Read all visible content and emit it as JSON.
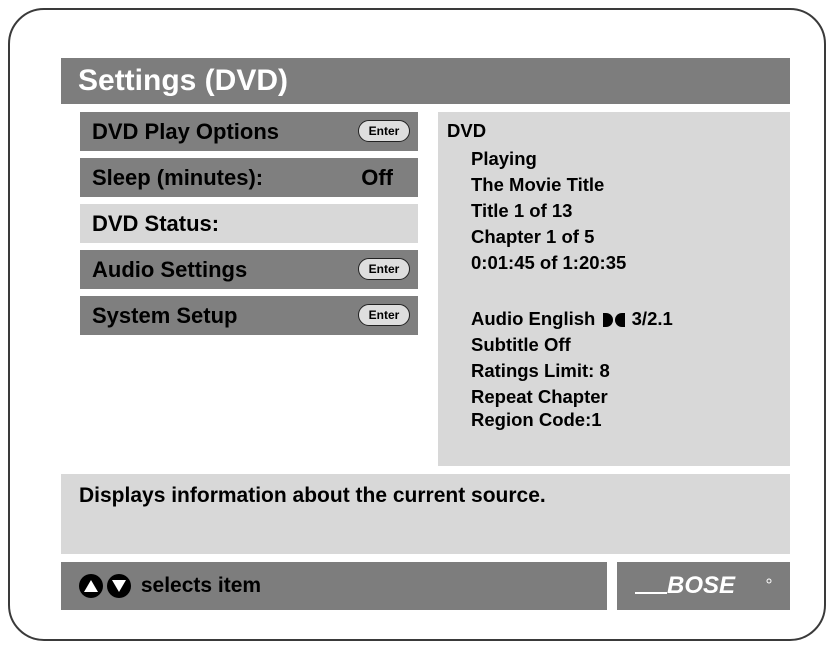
{
  "header": {
    "title": "Settings (DVD)"
  },
  "menu": {
    "items": [
      {
        "label": "DVD Play Options",
        "action": "Enter"
      },
      {
        "label": "Sleep (minutes):",
        "value": "Off"
      },
      {
        "label": "DVD Status:"
      },
      {
        "label": "Audio Settings",
        "action": "Enter"
      },
      {
        "label": "System Setup",
        "action": "Enter"
      }
    ]
  },
  "status": {
    "source": "DVD",
    "lines": [
      "Playing",
      "The Movie Title",
      "Title 1 of 13",
      "Chapter 1 of 5",
      "0:01:45 of 1:20:35"
    ],
    "audio_prefix": "Audio English",
    "audio_suffix": "3/2.1",
    "details": [
      "Subtitle Off",
      "Ratings Limit: 8",
      "Repeat Chapter",
      "Region Code:1"
    ]
  },
  "description": {
    "text": "Displays information about the current source."
  },
  "footer": {
    "hint": "selects item"
  },
  "brand": {
    "logo": "BOSE"
  },
  "colors": {
    "dark_gray": "#7d7d7d",
    "light_gray": "#d8d8d8",
    "text": "#000000",
    "title_text": "#ffffff"
  }
}
